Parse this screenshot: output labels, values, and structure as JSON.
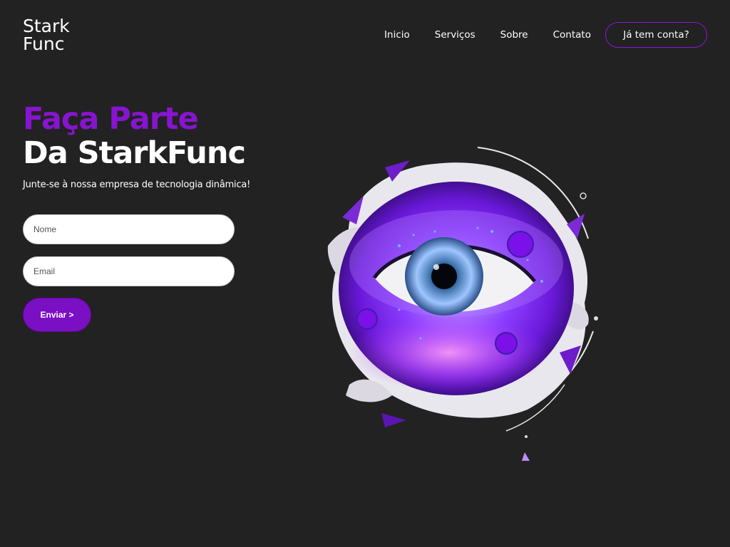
{
  "brand": {
    "line1": "Stark",
    "line2": "Func"
  },
  "nav": {
    "items": [
      "Inicio",
      "Serviços",
      "Sobre",
      "Contato"
    ],
    "login_label": "Já tem conta?"
  },
  "hero": {
    "title_line1": "Faça Parte",
    "title_line2": "Da StarkFunc",
    "subtitle": "Junte-se à nossa empresa de tecnologia dinâmica!"
  },
  "form": {
    "name_placeholder": "Nome",
    "email_placeholder": "Email",
    "submit_label": "Enviar >"
  },
  "colors": {
    "background": "#222222",
    "accent": "#8714cf",
    "button": "#7b0fc4"
  }
}
